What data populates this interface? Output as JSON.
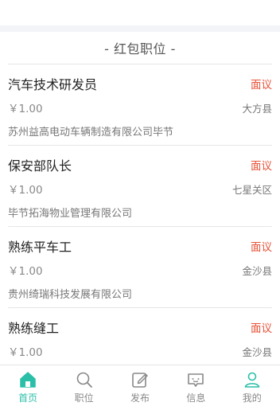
{
  "section": {
    "title": "- 红包职位 -"
  },
  "jobs": [
    {
      "title": "汽车技术研发员",
      "salary": "面议",
      "price": "￥1.00",
      "location": "大方县",
      "company": "苏州益高电动车辆制造有限公司毕节"
    },
    {
      "title": "保安部队长",
      "salary": "面议",
      "price": "￥1.00",
      "location": "七星关区",
      "company": "毕节拓海物业管理有限公司"
    },
    {
      "title": "熟练平车工",
      "salary": "面议",
      "price": "￥1.00",
      "location": "金沙县",
      "company": "贵州绮瑞科技发展有限公司"
    },
    {
      "title": "熟练缝工",
      "salary": "面议",
      "price": "￥1.00",
      "location": "金沙县",
      "company": ""
    }
  ],
  "tabbar": {
    "items": [
      {
        "label": "首页",
        "icon": "home-icon",
        "active": true
      },
      {
        "label": "职位",
        "icon": "search-icon",
        "active": false
      },
      {
        "label": "发布",
        "icon": "edit-icon",
        "active": false
      },
      {
        "label": "信息",
        "icon": "message-icon",
        "active": false
      },
      {
        "label": "我的",
        "icon": "user-icon",
        "active": false
      }
    ]
  },
  "colors": {
    "accent": "#2bbfa8",
    "salary": "#e8543a",
    "background_strip": "#f2f4f7"
  }
}
